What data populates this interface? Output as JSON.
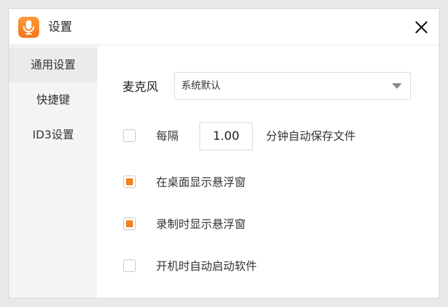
{
  "window": {
    "title": "设置",
    "accent_color": "#f5821f"
  },
  "sidebar": {
    "items": [
      {
        "label": "通用设置",
        "active": true
      },
      {
        "label": "快捷键",
        "active": false
      },
      {
        "label": "ID3设置",
        "active": false
      }
    ]
  },
  "general": {
    "microphone": {
      "label": "麦克风",
      "selected": "系统默认"
    },
    "autosave": {
      "checked": false,
      "prefix": "每隔",
      "interval": "1.00",
      "suffix": "分钟自动保存文件"
    },
    "options": [
      {
        "label": "在桌面显示悬浮窗",
        "checked": true
      },
      {
        "label": "录制时显示悬浮窗",
        "checked": true
      },
      {
        "label": "开机时自动启动软件",
        "checked": false
      }
    ]
  },
  "icons": {
    "app": "microphone-icon",
    "close": "close-icon",
    "dropdown": "chevron-down-icon"
  }
}
